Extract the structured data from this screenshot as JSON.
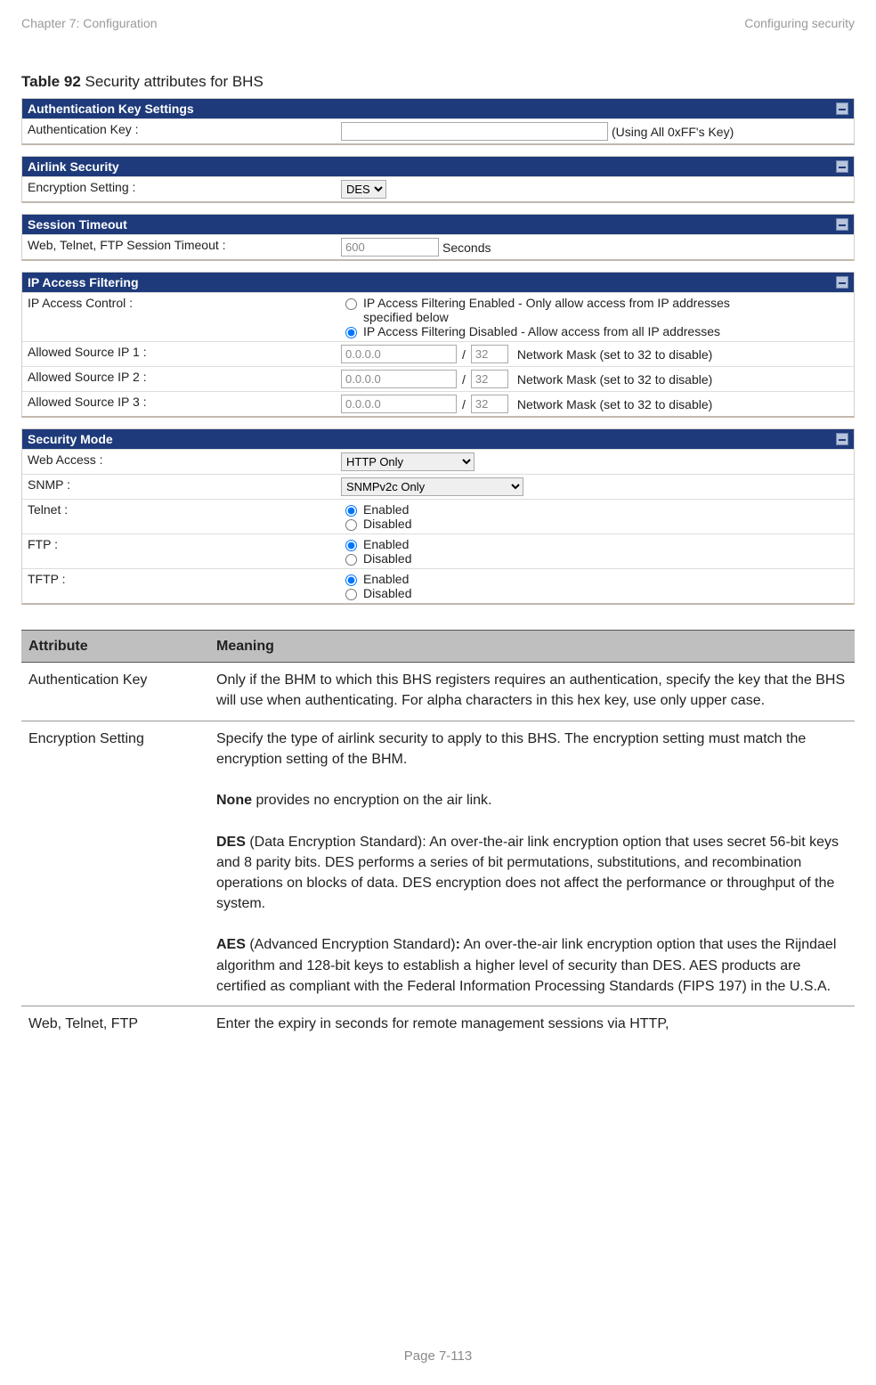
{
  "header": {
    "left": "Chapter 7:  Configuration",
    "right": "Configuring security"
  },
  "caption": {
    "num": "Table 92",
    "title": "  Security attributes for BHS"
  },
  "panels": {
    "auth": {
      "title": "Authentication Key Settings",
      "label": "Authentication Key :",
      "value": "",
      "suffix": "(Using All 0xFF's Key)"
    },
    "airlink": {
      "title": "Airlink Security",
      "label": "Encryption Setting :",
      "option": "DES"
    },
    "session": {
      "title": "Session Timeout",
      "label": "Web, Telnet, FTP Session Timeout :",
      "value": "600",
      "suffix": "Seconds"
    },
    "ipfilter": {
      "title": "IP Access Filtering",
      "control_label": "IP Access Control :",
      "opt_enabled": "IP Access Filtering Enabled - Only allow access from IP addresses specified below",
      "opt_disabled": "IP Access Filtering Disabled - Allow access from all IP addresses",
      "src1_label": "Allowed Source IP 1 :",
      "src2_label": "Allowed Source IP 2 :",
      "src3_label": "Allowed Source IP 3 :",
      "ip_value": "0.0.0.0",
      "slash": "/",
      "mask_value": "32",
      "mask_note": "Network Mask (set to 32 to disable)"
    },
    "secmode": {
      "title": "Security Mode",
      "web_label": "Web Access :",
      "web_value": "HTTP Only",
      "snmp_label": "SNMP :",
      "snmp_value": "SNMPv2c Only",
      "telnet_label": "Telnet :",
      "ftp_label": "FTP :",
      "tftp_label": "TFTP :",
      "enabled": "Enabled",
      "disabled": "Disabled"
    }
  },
  "deftable": {
    "hdr_attr": "Attribute",
    "hdr_mean": "Meaning",
    "rows": [
      {
        "attr": "Authentication Key",
        "mean": "Only if the BHM to which this BHS registers requires an authentication, specify the key that the BHS will use when authenticating. For alpha characters in this hex key, use only upper case."
      },
      {
        "attr": "Encryption Setting",
        "lead": "Specify the type of airlink security to apply to this BHS. The encryption setting must match the encryption setting of the BHM.",
        "none_label": "None",
        "none_text": " provides no encryption on the air link.",
        "des_label": "DES",
        "des_text": " (Data Encryption Standard):  An over-the-air link encryption option that uses secret 56-bit keys and 8 parity bits.  DES performs a series of bit permutations, substitutions, and recombination operations on blocks of data.  DES encryption does not affect the performance or throughput of the system.",
        "aes_label": "AES",
        "aes_colon": ":",
        "aes_pre": " (Advanced Encryption Standard)",
        "aes_text": "  An over-the-air link encryption option that uses the Rijndael algorithm and 128-bit keys to establish a higher level of security than DES.  AES products are certified as compliant with the Federal Information Processing Standards (FIPS 197) in the U.S.A."
      },
      {
        "attr": "Web, Telnet, FTP",
        "mean": " Enter the expiry in seconds for remote management sessions via HTTP,"
      }
    ]
  },
  "footer": "Page 7-113"
}
